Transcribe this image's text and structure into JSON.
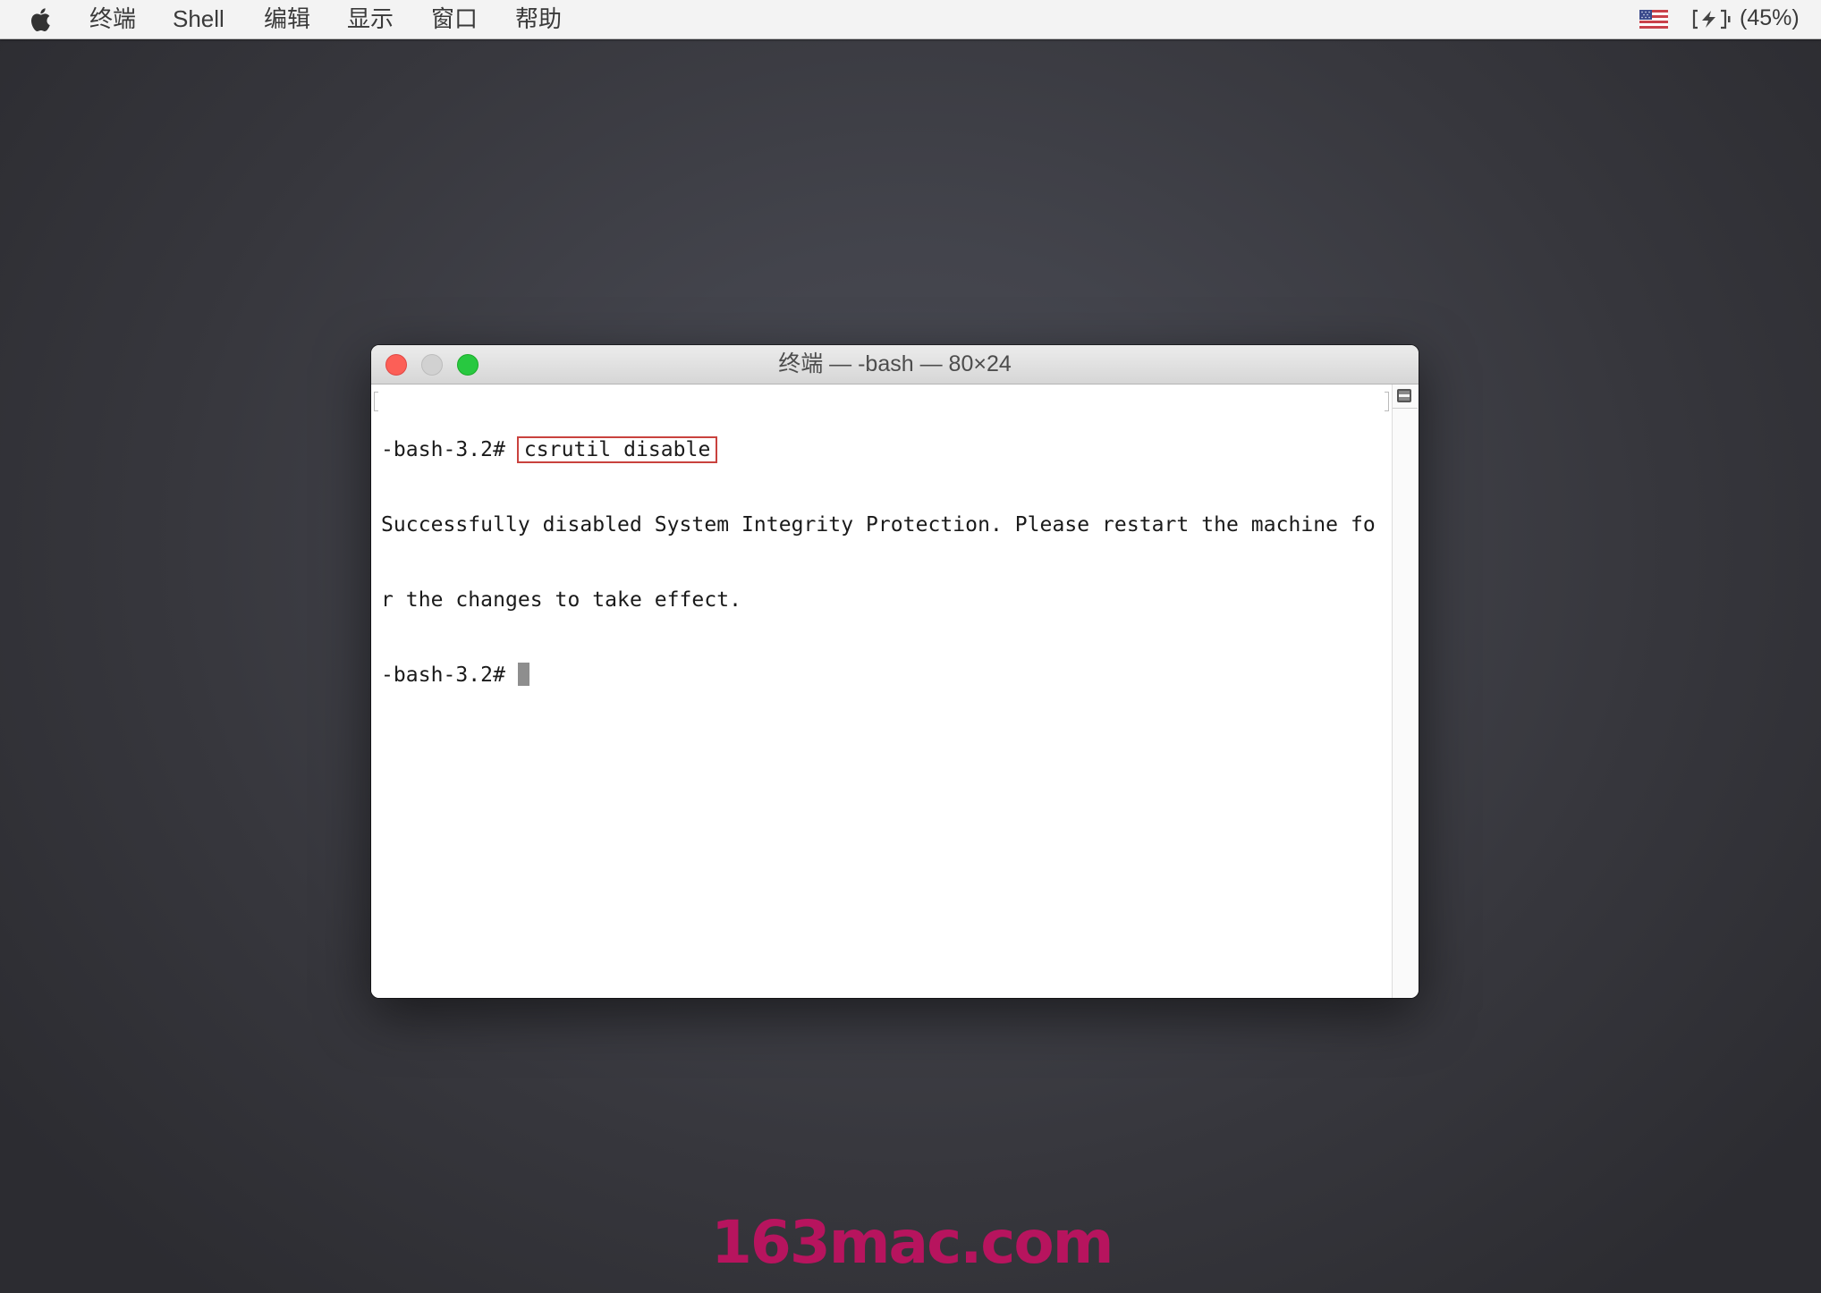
{
  "menubar": {
    "apple_icon": "apple-logo-icon",
    "items": [
      {
        "label": "终端"
      },
      {
        "label": "Shell"
      },
      {
        "label": "编辑"
      },
      {
        "label": "显示"
      },
      {
        "label": "窗口"
      },
      {
        "label": "帮助"
      }
    ],
    "status": {
      "input_source_icon": "us-flag-icon",
      "battery_icon": "battery-charging-icon",
      "battery_label": "(45%)"
    }
  },
  "window": {
    "title": "终端 — -bash — 80×24",
    "controls": [
      "close",
      "minimize",
      "zoom"
    ],
    "terminal": {
      "prompt": "-bash-3.2#",
      "command": "csrutil disable",
      "output_lines": [
        "Successfully disabled System Integrity Protection. Please restart the machine fo",
        "r the changes to take effect."
      ],
      "next_prompt": "-bash-3.2#"
    },
    "highlight_color": "#c9423e"
  },
  "watermark": {
    "text": "163mac.com",
    "color": "#b7145e"
  }
}
